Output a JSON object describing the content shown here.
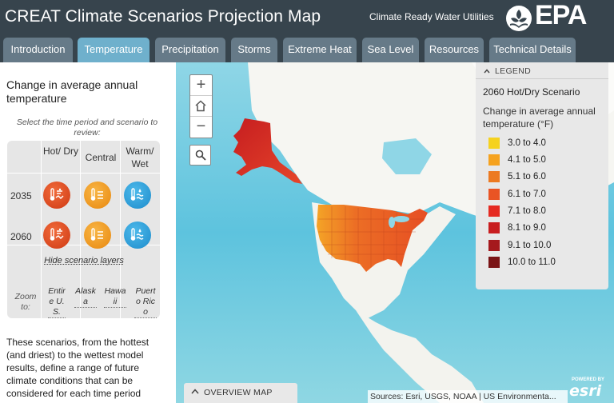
{
  "header": {
    "title": "CREAT Climate Scenarios Projection Map",
    "tagline": "Climate Ready Water Utilities",
    "logo_text": "EPA"
  },
  "tabs": [
    {
      "label": "Introduction",
      "active": false
    },
    {
      "label": "Temperature",
      "active": true
    },
    {
      "label": "Precipitation",
      "active": false
    },
    {
      "label": "Storms",
      "active": false
    },
    {
      "label": "Extreme Heat",
      "active": false
    },
    {
      "label": "Sea Level",
      "active": false
    },
    {
      "label": "Resources",
      "active": false
    },
    {
      "label": "Technical Details",
      "active": false
    }
  ],
  "panel": {
    "title": "Change in average annual temperature",
    "instructions": "Select the time period and scenario to review:",
    "columns": [
      "Hot/ Dry",
      "Central",
      "Warm/ Wet"
    ],
    "rows": [
      "2035",
      "2060"
    ],
    "hide_link": "Hide scenario layers",
    "zoom_label": "Zoom to:",
    "zoom_links": [
      "Entire U.S.",
      "Alaska",
      "Hawaii",
      "Puerto Rico"
    ],
    "description": "These scenarios, from the hottest (and driest) to the wettest model results, define a range of future climate conditions that can be considered for each time period"
  },
  "map": {
    "zoom_in": "+",
    "zoom_out": "−",
    "legend": {
      "header": "LEGEND",
      "scenario": "2060 Hot/Dry Scenario",
      "subtitle": "Change in average annual temperature (°F)",
      "items": [
        {
          "label": "3.0 to 4.0",
          "color": "#f5d21f"
        },
        {
          "label": "4.1 to 5.0",
          "color": "#f5a21f"
        },
        {
          "label": "5.1 to 6.0",
          "color": "#ec7a22"
        },
        {
          "label": "6.1 to 7.0",
          "color": "#e95424"
        },
        {
          "label": "7.1 to 8.0",
          "color": "#e52a22"
        },
        {
          "label": "8.1 to 9.0",
          "color": "#c81d1f"
        },
        {
          "label": "9.1 to 10.0",
          "color": "#a5191d"
        },
        {
          "label": "10.0 to 11.0",
          "color": "#7a1416"
        }
      ]
    },
    "overview_label": "OVERVIEW MAP",
    "attribution": "Sources: Esri, USGS, NOAA | US Environmenta...",
    "esri_powered": "POWERED BY",
    "esri_logo": "esri"
  },
  "colors": {
    "header_bg": "#37444d",
    "tab_bg": "#667a88",
    "tab_active": "#6fb0cc",
    "hot_dry": "#e14a1c",
    "central": "#f09a1a",
    "warm_wet": "#2a9fd8"
  }
}
